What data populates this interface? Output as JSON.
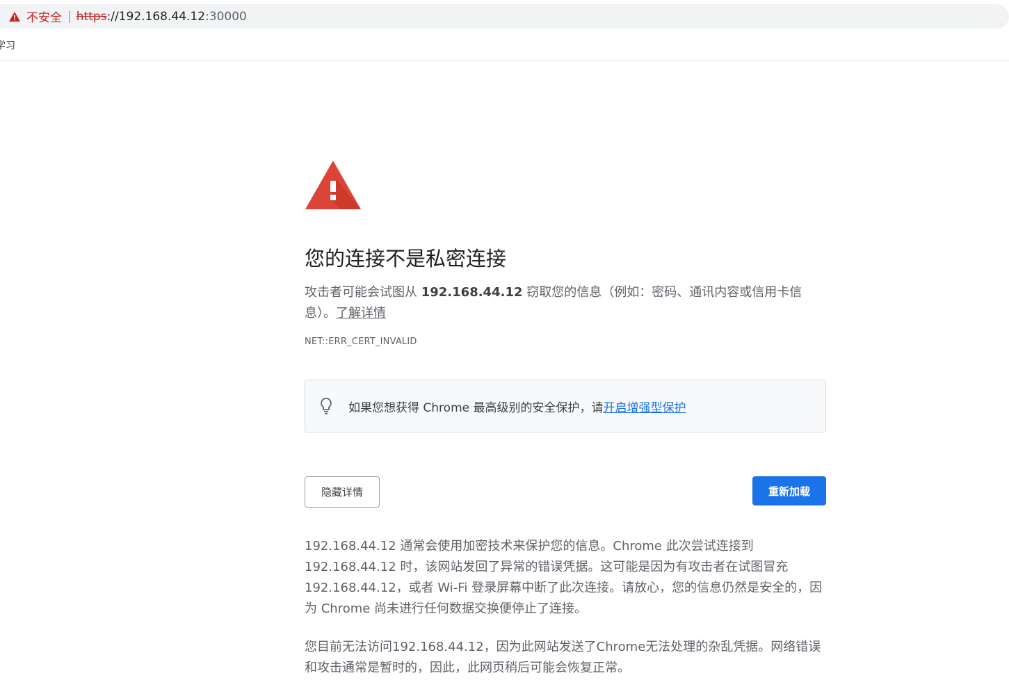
{
  "address_bar": {
    "security_label": "不安全",
    "separator": "|",
    "url_scheme": "https",
    "url_rest": "://192.168.44.12",
    "url_port": ":30000"
  },
  "bookmarks": {
    "items": [
      {
        "label": "学习"
      }
    ]
  },
  "interstitial": {
    "title": "您的连接不是私密连接",
    "desc_prefix": "攻击者可能会试图从 ",
    "desc_host": "192.168.44.12",
    "desc_suffix": " 窃取您的信息（例如：密码、通讯内容或信用卡信息）。",
    "learn_more": "了解详情",
    "error_code": "NET::ERR_CERT_INVALID",
    "tip_text": "如果您想获得 Chrome 最高级别的安全保护，请",
    "tip_link": "开启增强型保护",
    "hide_details_label": "隐藏详情",
    "reload_label": "重新加载",
    "details_paragraph_1": "192.168.44.12 通常会使用加密技术来保护您的信息。Chrome 此次尝试连接到 192.168.44.12 时，该网站发回了异常的错误凭据。这可能是因为有攻击者在试图冒充 192.168.44.12，或者 Wi-Fi 登录屏幕中断了此次连接。请放心，您的信息仍然是安全的，因为 Chrome 尚未进行任何数据交换便停止了连接。",
    "details_paragraph_2": "您目前无法访问192.168.44.12，因为此网站发送了Chrome无法处理的杂乱凭据。网络错误和攻击通常是暂时的，因此，此网页稍后可能会恢复正常。"
  },
  "colors": {
    "accent": "#1a73e8",
    "danger": "#db4437",
    "not_secure_red": "#c5221f"
  },
  "icons": [
    "warning-triangle-icon",
    "lightbulb-icon"
  ]
}
